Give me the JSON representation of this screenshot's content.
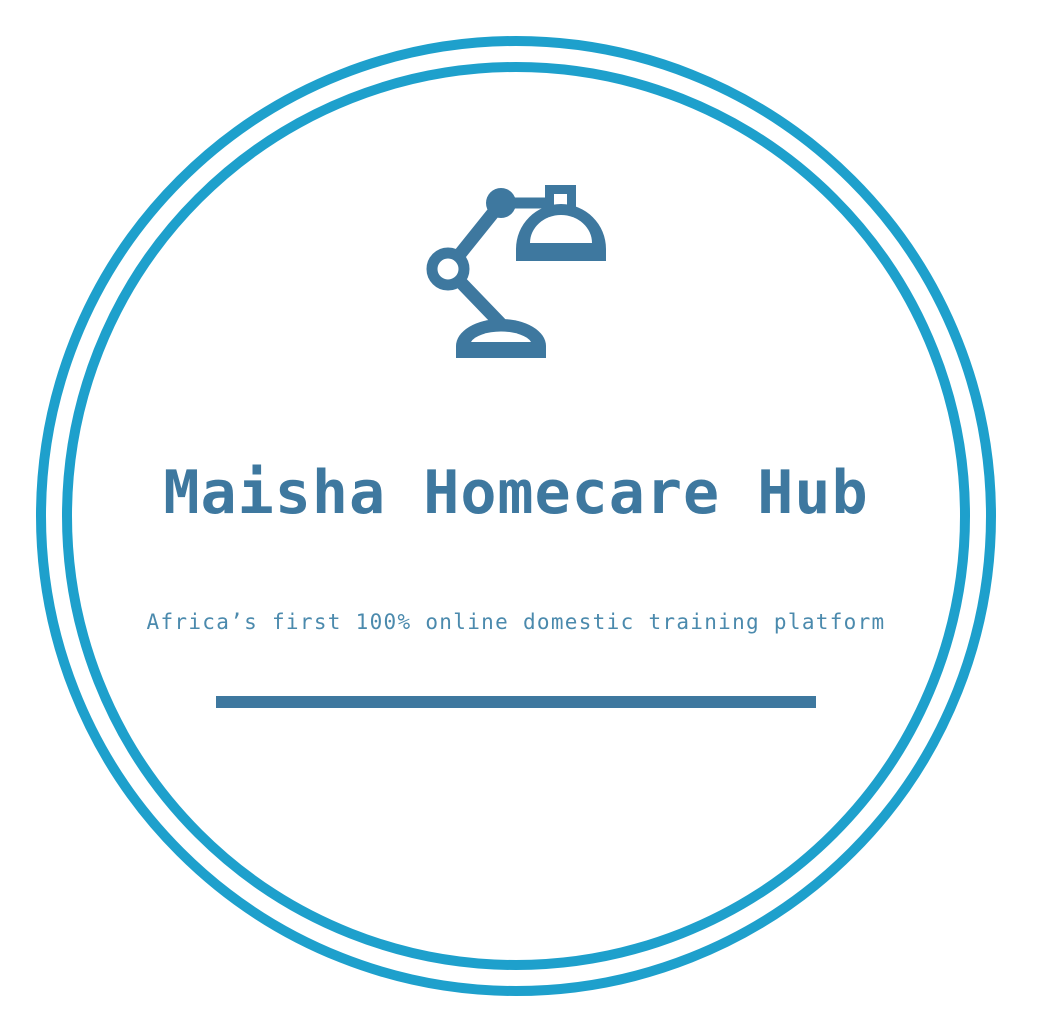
{
  "logo": {
    "name": "Maisha Homecare Hub",
    "tagline": "Africa’s first 100% online domestic training platform",
    "icon": "desk-lamp-icon",
    "colors": {
      "ring": "#1ea0cc",
      "brand": "#3e789f",
      "tagline": "#4b8aad",
      "background": "#ffffff"
    }
  }
}
